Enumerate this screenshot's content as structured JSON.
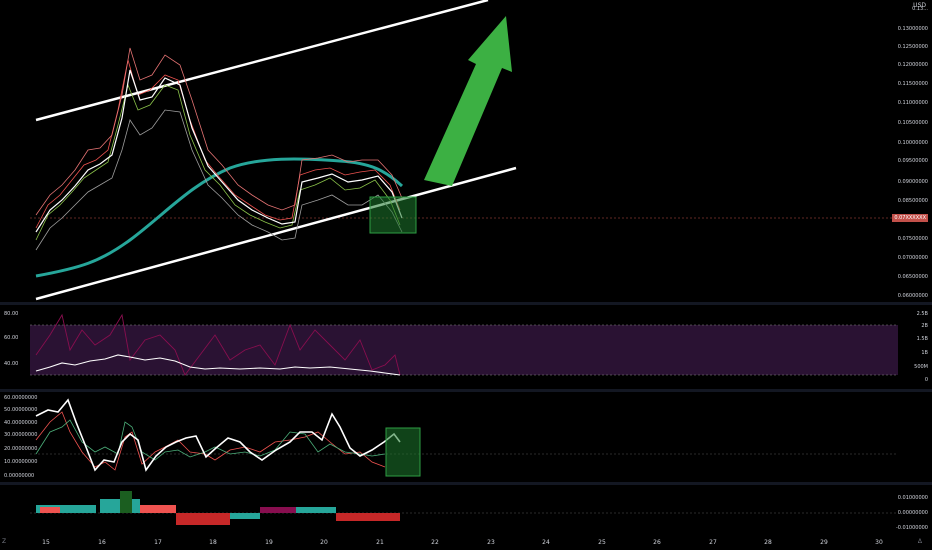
{
  "currency": "USD",
  "price_scale": [
    "0.13000000",
    "0.12500000",
    "0.12000000",
    "0.11500000",
    "0.11000000",
    "0.10500000",
    "0.10000000",
    "0.09500000",
    "0.09000000",
    "0.08500000",
    "0.07500000",
    "0.07000000",
    "0.06500000",
    "0.06000000"
  ],
  "price_scale_top": "0.13...",
  "current_price": "0.07XXXXXX",
  "rsi_left_scale": [
    "80.00",
    "60.00",
    "40.00"
  ],
  "rsi_right_scale": [
    "2.5B",
    "2B",
    "1.5B",
    "1B",
    "500M",
    "0"
  ],
  "osc_left_scale": [
    "60.00000000",
    "50.00000000",
    "40.00000000",
    "30.00000000",
    "20.00000000",
    "10.00000000",
    "0.00000000"
  ],
  "hist_right_scale": [
    "0.01000000",
    "0.00000000",
    "-0.01000000"
  ],
  "time_axis": [
    "15",
    "16",
    "17",
    "18",
    "19",
    "20",
    "21",
    "22",
    "23",
    "24",
    "25",
    "26",
    "27",
    "28",
    "29",
    "30"
  ],
  "corner_left": "Z",
  "corner_right": "Δ",
  "colors": {
    "background": "#000000",
    "channel": "#ffffff",
    "ma": "#26a69a",
    "arrow": "#3cb043",
    "box": "#1e7a2e",
    "rsi_fill": "#2a1233",
    "price_tag": "#c2504a"
  }
}
